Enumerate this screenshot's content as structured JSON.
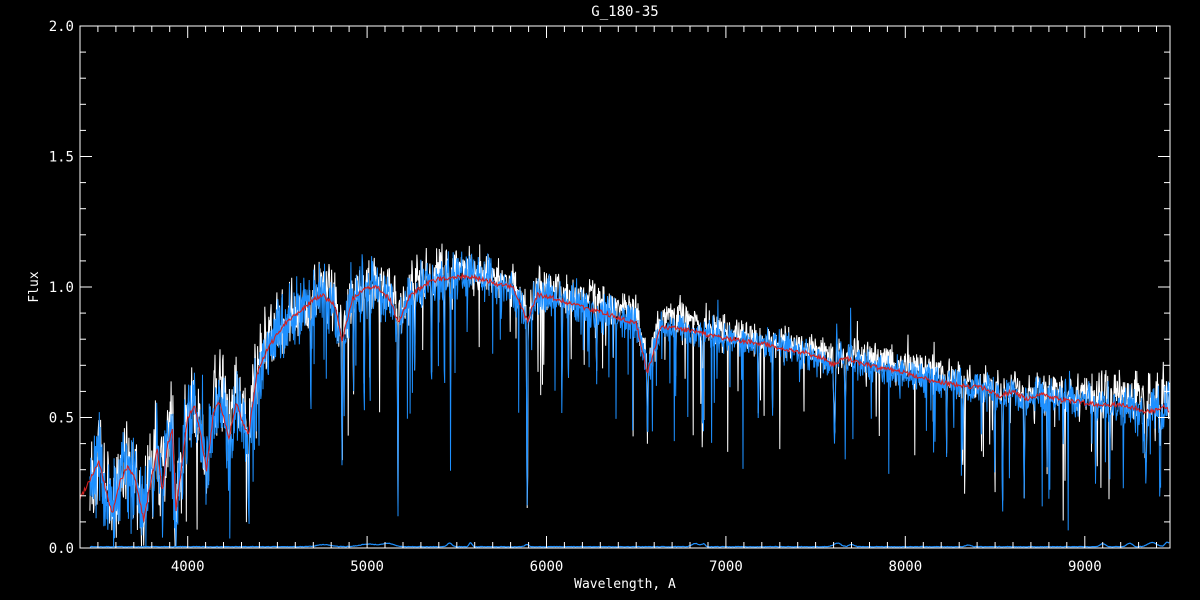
{
  "window": {
    "background": "#000000"
  },
  "chart_data": {
    "type": "line",
    "title": "G_180-35",
    "xlabel": "Wavelength, A",
    "ylabel": "Flux",
    "xlim": [
      3400,
      9475
    ],
    "ylim": [
      0.0,
      2.0
    ],
    "x_major_ticks": [
      4000,
      5000,
      6000,
      7000,
      8000,
      9000
    ],
    "x_minor_step": 100,
    "y_major_ticks": [
      0.0,
      0.5,
      1.0,
      1.5,
      2.0
    ],
    "y_major_tick_labels": [
      "0.0",
      "0.5",
      "1.0",
      "1.5",
      "2.0"
    ],
    "y_minor_step": 0.1,
    "grid": false,
    "legend": "none",
    "axis_color": "#ffffff",
    "background_color": "#000000",
    "series": [
      {
        "name": "template-spectrum",
        "color": "#ffffff",
        "style": "noisy"
      },
      {
        "name": "observed-spectrum",
        "color": "#1e90ff",
        "style": "noisy"
      },
      {
        "name": "error-spectrum",
        "color": "#1e90ff",
        "style": "flat-near-zero"
      },
      {
        "name": "smoothed-fit",
        "color": "#d42020",
        "style": "smooth"
      }
    ],
    "wavelength_range_data": [
      3455,
      9470
    ],
    "sample_step_A": 2.5,
    "continuum_anchors": [
      [
        3400,
        0.19
      ],
      [
        3460,
        0.27
      ],
      [
        3505,
        0.33
      ],
      [
        3545,
        0.22
      ],
      [
        3580,
        0.13
      ],
      [
        3625,
        0.26
      ],
      [
        3665,
        0.31
      ],
      [
        3705,
        0.27
      ],
      [
        3755,
        0.11
      ],
      [
        3800,
        0.27
      ],
      [
        3830,
        0.38
      ],
      [
        3860,
        0.22
      ],
      [
        3890,
        0.4
      ],
      [
        3915,
        0.45
      ],
      [
        3935,
        0.15
      ],
      [
        3960,
        0.28
      ],
      [
        4000,
        0.5
      ],
      [
        4040,
        0.54
      ],
      [
        4075,
        0.42
      ],
      [
        4105,
        0.3
      ],
      [
        4145,
        0.52
      ],
      [
        4180,
        0.56
      ],
      [
        4230,
        0.42
      ],
      [
        4270,
        0.56
      ],
      [
        4310,
        0.47
      ],
      [
        4340,
        0.44
      ],
      [
        4385,
        0.66
      ],
      [
        4430,
        0.74
      ],
      [
        4480,
        0.8
      ],
      [
        4540,
        0.86
      ],
      [
        4610,
        0.9
      ],
      [
        4680,
        0.94
      ],
      [
        4750,
        0.97
      ],
      [
        4820,
        0.93
      ],
      [
        4861,
        0.79
      ],
      [
        4915,
        0.95
      ],
      [
        4980,
        0.99
      ],
      [
        5060,
        1.0
      ],
      [
        5130,
        0.95
      ],
      [
        5175,
        0.86
      ],
      [
        5235,
        0.96
      ],
      [
        5320,
        1.01
      ],
      [
        5400,
        1.03
      ],
      [
        5480,
        1.04
      ],
      [
        5560,
        1.04
      ],
      [
        5650,
        1.03
      ],
      [
        5730,
        1.01
      ],
      [
        5810,
        1.0
      ],
      [
        5892,
        0.87
      ],
      [
        5950,
        0.97
      ],
      [
        6030,
        0.96
      ],
      [
        6120,
        0.94
      ],
      [
        6220,
        0.92
      ],
      [
        6320,
        0.9
      ],
      [
        6420,
        0.88
      ],
      [
        6500,
        0.86
      ],
      [
        6563,
        0.67
      ],
      [
        6640,
        0.85
      ],
      [
        6730,
        0.84
      ],
      [
        6830,
        0.83
      ],
      [
        6930,
        0.81
      ],
      [
        7030,
        0.8
      ],
      [
        7130,
        0.79
      ],
      [
        7230,
        0.78
      ],
      [
        7330,
        0.76
      ],
      [
        7430,
        0.75
      ],
      [
        7530,
        0.73
      ],
      [
        7600,
        0.7
      ],
      [
        7660,
        0.73
      ],
      [
        7750,
        0.71
      ],
      [
        7850,
        0.69
      ],
      [
        7950,
        0.68
      ],
      [
        8050,
        0.66
      ],
      [
        8150,
        0.64
      ],
      [
        8250,
        0.63
      ],
      [
        8350,
        0.62
      ],
      [
        8450,
        0.61
      ],
      [
        8520,
        0.58
      ],
      [
        8600,
        0.6
      ],
      [
        8670,
        0.57
      ],
      [
        8760,
        0.59
      ],
      [
        8860,
        0.57
      ],
      [
        8960,
        0.56
      ],
      [
        9060,
        0.55
      ],
      [
        9160,
        0.55
      ],
      [
        9260,
        0.54
      ],
      [
        9360,
        0.52
      ],
      [
        9440,
        0.54
      ],
      [
        9500,
        0.51
      ]
    ],
    "noise_sigma_anchors": [
      [
        3455,
        0.125
      ],
      [
        3800,
        0.12
      ],
      [
        4200,
        0.1
      ],
      [
        4600,
        0.085
      ],
      [
        5000,
        0.075
      ],
      [
        5400,
        0.065
      ],
      [
        5800,
        0.055
      ],
      [
        6200,
        0.05
      ],
      [
        6600,
        0.045
      ],
      [
        7000,
        0.042
      ],
      [
        7400,
        0.04
      ],
      [
        7800,
        0.042
      ],
      [
        8200,
        0.044
      ],
      [
        8600,
        0.045
      ],
      [
        9000,
        0.05
      ],
      [
        9200,
        0.06
      ],
      [
        9475,
        0.075
      ]
    ],
    "template_offset_anchors": [
      [
        3455,
        0.02
      ],
      [
        4000,
        0.05
      ],
      [
        4300,
        0.06
      ],
      [
        4600,
        0.03
      ],
      [
        4900,
        0.02
      ],
      [
        5200,
        0.045
      ],
      [
        5500,
        0.04
      ],
      [
        5800,
        0.02
      ],
      [
        6100,
        0.03
      ],
      [
        6400,
        0.045
      ],
      [
        6900,
        0.035
      ],
      [
        7300,
        0.02
      ],
      [
        7700,
        0.025
      ],
      [
        8100,
        0.035
      ],
      [
        8500,
        0.02
      ],
      [
        8900,
        0.025
      ],
      [
        9200,
        0.05
      ],
      [
        9475,
        0.06
      ]
    ],
    "absorption_lines": [
      [
        3933,
        0.15,
        8
      ],
      [
        3970,
        0.1,
        8
      ],
      [
        4102,
        0.12,
        8
      ],
      [
        4227,
        0.12,
        6
      ],
      [
        4340,
        0.3,
        7
      ],
      [
        4383,
        0.18,
        5
      ],
      [
        4686,
        0.35,
        4
      ],
      [
        4861,
        0.5,
        5
      ],
      [
        4925,
        0.45,
        4
      ],
      [
        4984,
        0.55,
        4
      ],
      [
        5015,
        0.35,
        4
      ],
      [
        5172,
        0.82,
        4
      ],
      [
        5265,
        0.35,
        4
      ],
      [
        5359,
        0.45,
        4
      ],
      [
        5430,
        0.3,
        4
      ],
      [
        5465,
        0.45,
        4
      ],
      [
        5892,
        0.78,
        5
      ],
      [
        6086,
        0.4,
        4
      ],
      [
        6122,
        0.3,
        4
      ],
      [
        6280,
        0.28,
        4
      ],
      [
        6563,
        0.26,
        6
      ],
      [
        6720,
        0.25,
        4
      ],
      [
        6869,
        0.4,
        5
      ],
      [
        7180,
        0.28,
        4
      ],
      [
        7260,
        0.24,
        4
      ],
      [
        7605,
        0.28,
        9
      ],
      [
        7665,
        0.22,
        6
      ],
      [
        8230,
        0.28,
        4
      ],
      [
        8320,
        0.26,
        4
      ],
      [
        8424,
        0.22,
        4
      ],
      [
        8498,
        0.28,
        5
      ],
      [
        8542,
        0.42,
        5
      ],
      [
        8662,
        0.4,
        5
      ],
      [
        8790,
        0.28,
        4
      ],
      [
        8880,
        0.24,
        4
      ],
      [
        9060,
        0.28,
        4
      ],
      [
        9140,
        0.26,
        4
      ],
      [
        9340,
        0.24,
        12
      ],
      [
        9420,
        0.22,
        10
      ]
    ],
    "emission_spikes": [
      [
        7617,
        0.16,
        4
      ],
      [
        7640,
        0.1,
        3
      ],
      [
        5577,
        0.05,
        3
      ]
    ],
    "error_baseline": 0.005,
    "error_bumps": [
      [
        4760,
        0.008,
        40
      ],
      [
        5010,
        0.01,
        50
      ],
      [
        5120,
        0.012,
        30
      ],
      [
        5460,
        0.014,
        12
      ],
      [
        5577,
        0.016,
        8
      ],
      [
        5890,
        0.008,
        10
      ],
      [
        6830,
        0.012,
        20
      ],
      [
        6875,
        0.01,
        10
      ],
      [
        7620,
        0.014,
        20
      ],
      [
        7700,
        0.008,
        15
      ],
      [
        8350,
        0.006,
        15
      ],
      [
        9100,
        0.012,
        15
      ],
      [
        9250,
        0.014,
        15
      ],
      [
        9375,
        0.016,
        25
      ],
      [
        9460,
        0.018,
        12
      ]
    ]
  }
}
